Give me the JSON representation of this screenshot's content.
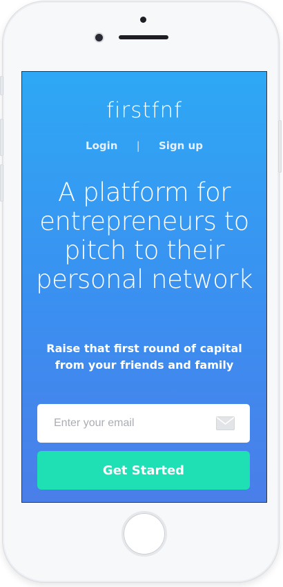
{
  "app": {
    "logo_text": "firstfnf",
    "nav": {
      "login": "Login",
      "separator": "|",
      "signup": "Sign up"
    },
    "headline": "A platform for entrepreneurs to pitch to their personal network",
    "subheadline": "Raise that first round of capital from your friends and family",
    "email_field": {
      "placeholder": "Enter your email",
      "value": "",
      "icon": "mail-icon"
    },
    "cta_label": "Get Started"
  },
  "colors": {
    "gradient_top": "#2ea8f4",
    "gradient_bottom": "#4a7ee9",
    "cta": "#1fdfb4",
    "text": "#ffffff"
  }
}
